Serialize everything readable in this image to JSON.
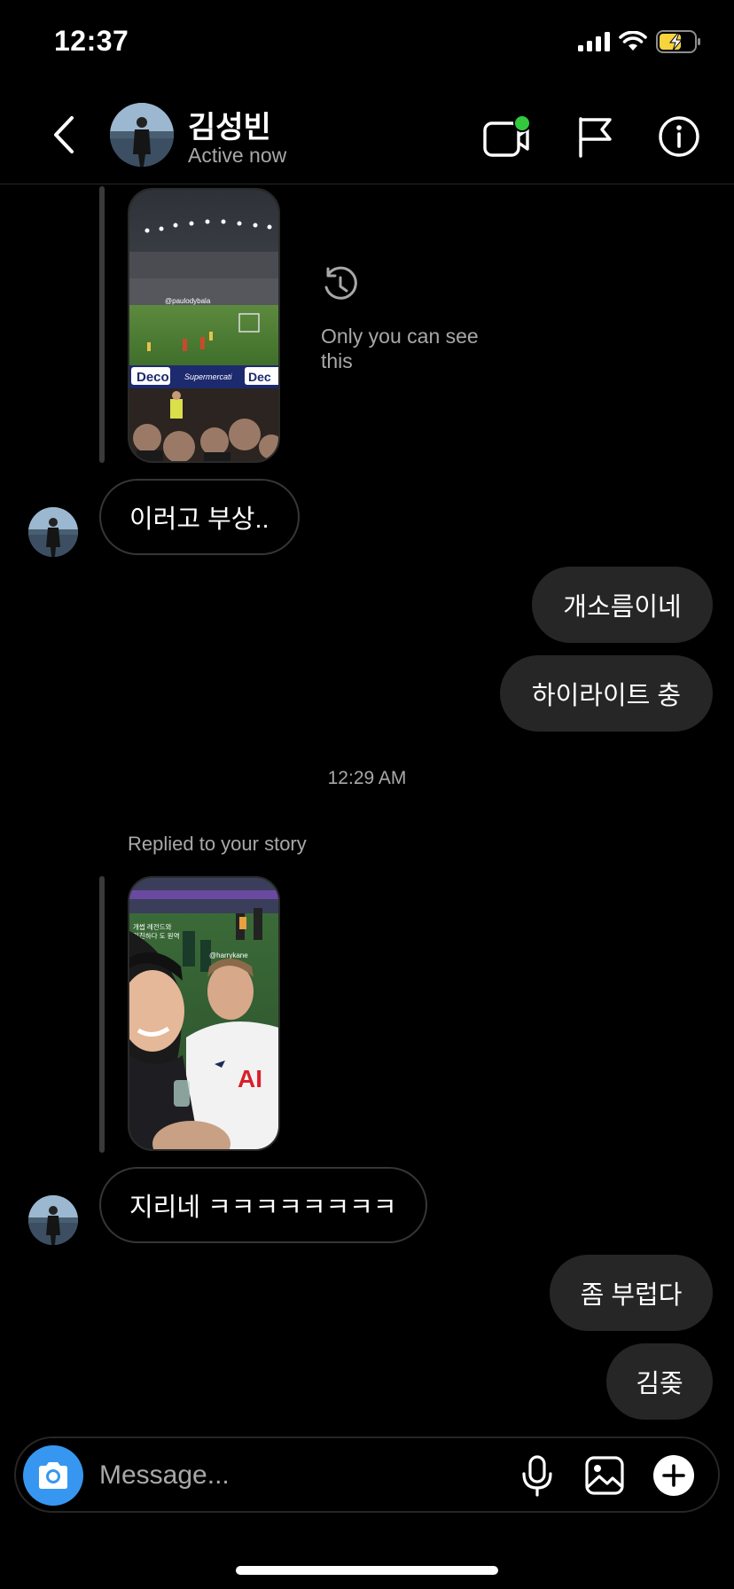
{
  "status_bar": {
    "time": "12:37",
    "icons": [
      "signal-icon",
      "wifi-icon",
      "battery-charging-icon"
    ]
  },
  "header": {
    "name": "김성빈",
    "status": "Active now",
    "actions": [
      "video-call-icon",
      "report-flag-icon",
      "info-icon"
    ],
    "online_dot_color": "#32c93c"
  },
  "chat": {
    "first_story": {
      "overlay_tag": "@paulodybala",
      "banner_left": "Deco",
      "banner_mid": "Supermercati",
      "banner_right": "Dec",
      "only_you_text": "Only you can see this"
    },
    "messages": [
      {
        "side": "in",
        "text": "이러고 부상.."
      },
      {
        "side": "out",
        "text": "개소름이네"
      },
      {
        "side": "out",
        "text": "하이라이트 충"
      }
    ],
    "timestamp": "12:29 AM",
    "replied_label": "Replied to your story",
    "second_story": {
      "caption_line1": "개썹 레전드와",
      "caption_line2": "미친하다 도 원역",
      "overlay_tag": "@harrykane",
      "shirt_text": "AI"
    },
    "messages_after": [
      {
        "side": "in",
        "text": "지리네 ㅋㅋㅋㅋㅋㅋㅋㅋ"
      },
      {
        "side": "out",
        "text": "좀 부럽다"
      },
      {
        "side": "out",
        "text": "김좆"
      }
    ]
  },
  "composer": {
    "placeholder": "Message...",
    "actions": [
      "microphone-icon",
      "gallery-icon",
      "add-icon"
    ]
  },
  "colors": {
    "background": "#000000",
    "outgoing_bubble": "#262626",
    "incoming_border": "#363636",
    "secondary_text": "#a8a8a8",
    "camera_button": "#3797f0",
    "battery_charging": "#f7d33e"
  }
}
